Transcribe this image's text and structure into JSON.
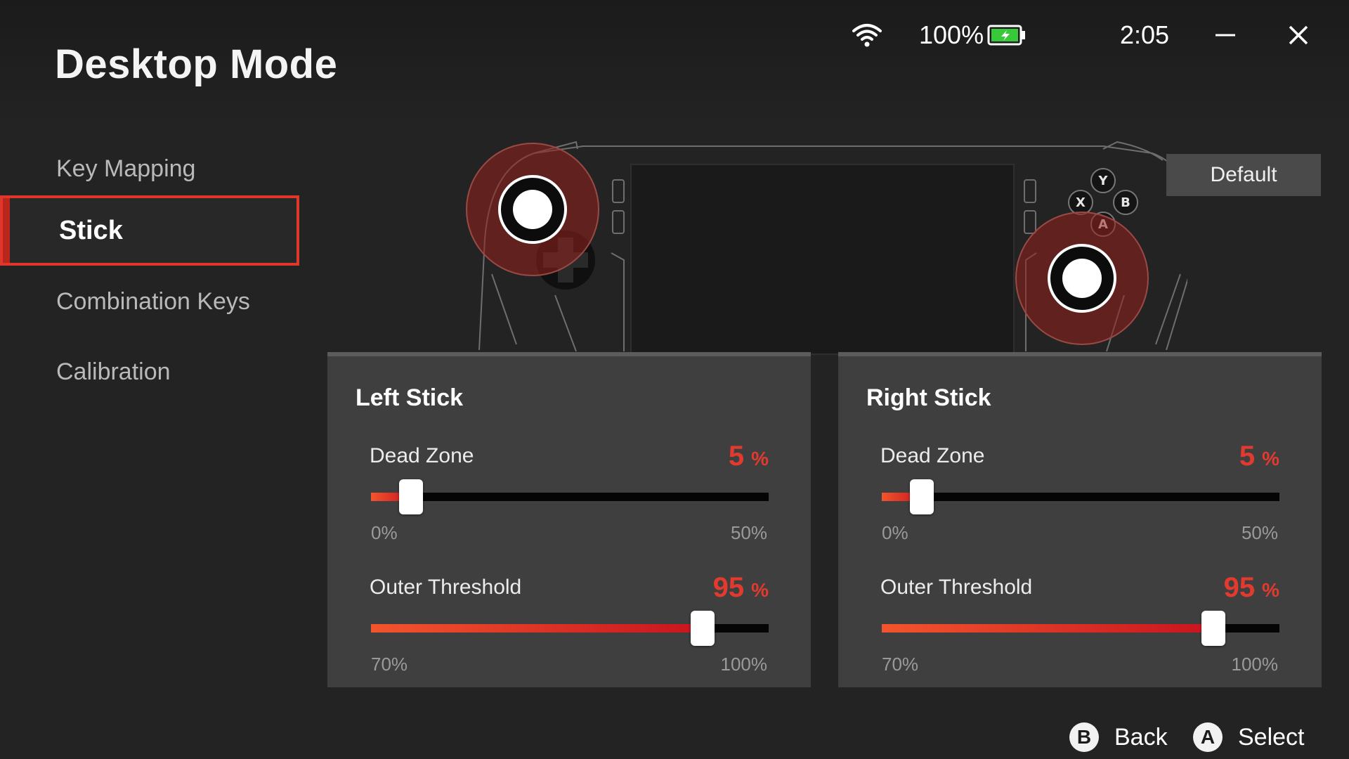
{
  "page": {
    "title": "Desktop Mode"
  },
  "status_bar": {
    "wifi_icon": "wifi-icon",
    "battery_percent": "100%",
    "battery_icon": "battery-charging-icon",
    "time": "2:05"
  },
  "window_controls": {
    "minimize_icon": "minimize-icon",
    "close_icon": "close-icon"
  },
  "sidebar": {
    "items": [
      {
        "label": "Key Mapping",
        "active": false
      },
      {
        "label": "Stick",
        "active": true
      },
      {
        "label": "Combination Keys",
        "active": false
      },
      {
        "label": "Calibration",
        "active": false
      }
    ]
  },
  "device": {
    "face_buttons": [
      "Y",
      "X",
      "B",
      "A"
    ]
  },
  "default_button": "Default",
  "left_stick": {
    "title": "Left Stick",
    "dead_zone": {
      "label": "Dead Zone",
      "value": "5",
      "unit": "%",
      "min": "0%",
      "max": "50%",
      "fraction": 0.1
    },
    "outer_threshold": {
      "label": "Outer Threshold",
      "value": "95",
      "unit": "%",
      "min": "70%",
      "max": "100%",
      "fraction": 0.8333
    }
  },
  "right_stick": {
    "title": "Right Stick",
    "dead_zone": {
      "label": "Dead Zone",
      "value": "5",
      "unit": "%",
      "min": "0%",
      "max": "50%",
      "fraction": 0.1
    },
    "outer_threshold": {
      "label": "Outer Threshold",
      "value": "95",
      "unit": "%",
      "min": "70%",
      "max": "100%",
      "fraction": 0.8333
    }
  },
  "footer": {
    "back": {
      "key": "B",
      "label": "Back"
    },
    "select": {
      "key": "A",
      "label": "Select"
    }
  },
  "colors": {
    "accent": "#e23a2e",
    "background": "#232323",
    "panel": "#3f3f3f"
  }
}
